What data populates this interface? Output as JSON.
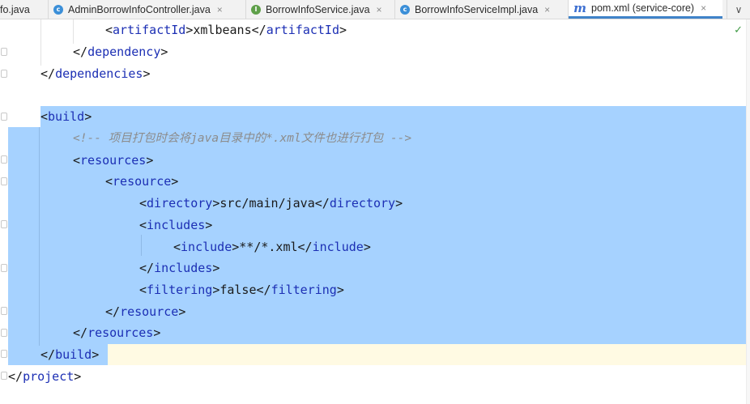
{
  "tabs": [
    {
      "label": "fo.java",
      "icon": "none",
      "closable": false,
      "active": false
    },
    {
      "label": "AdminBorrowInfoController.java",
      "icon": "class-icon",
      "icon_glyph": "c",
      "closable": true,
      "active": false
    },
    {
      "label": "BorrowInfoService.java",
      "icon": "interface-icon",
      "icon_glyph": "I",
      "closable": true,
      "active": false
    },
    {
      "label": "BorrowInfoServiceImpl.java",
      "icon": "class-icon",
      "icon_glyph": "c",
      "closable": true,
      "active": false
    },
    {
      "label": "pom.xml (service-core)",
      "icon": "maven-icon",
      "icon_glyph": "m",
      "closable": true,
      "active": true
    }
  ],
  "tab_close_glyph": "×",
  "tab_menu_glyph": "∨",
  "inspection_glyph": "✓",
  "code": {
    "l1": {
      "open_tag": "artifactId",
      "text": "xmlbeans",
      "close_tag": "artifactId"
    },
    "l2": {
      "close_tag": "dependency"
    },
    "l3": {
      "close_tag": "dependencies"
    },
    "l5": {
      "open_tag": "build"
    },
    "l6": {
      "comment": "<!-- 项目打包时会将java目录中的*.xml文件也进行打包 -->"
    },
    "l7": {
      "open_tag": "resources"
    },
    "l8": {
      "open_tag": "resource"
    },
    "l9": {
      "open_tag": "directory",
      "text": "src/main/java",
      "close_tag": "directory"
    },
    "l10": {
      "open_tag": "includes"
    },
    "l11": {
      "open_tag": "include",
      "text": "**/*.xml",
      "close_tag": "include"
    },
    "l12": {
      "close_tag": "includes"
    },
    "l13": {
      "open_tag": "filtering",
      "text": "false",
      "close_tag": "filtering"
    },
    "l14": {
      "close_tag": "resource"
    },
    "l15": {
      "close_tag": "resources"
    },
    "l16": {
      "close_tag": "build"
    },
    "l17": {
      "close_tag": "project"
    }
  },
  "colors": {
    "selection": "#a6d2ff",
    "tag": "#1c2fb4",
    "comment": "#8c8c8c",
    "active_tab_underline": "#4083c9",
    "check": "#3f9a44"
  }
}
